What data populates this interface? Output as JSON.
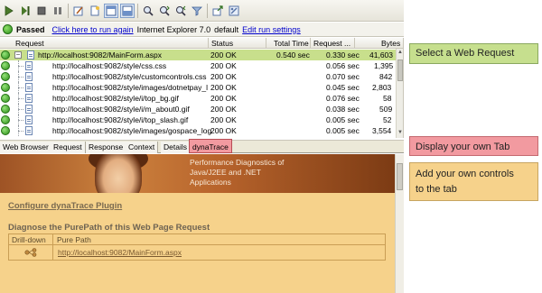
{
  "toolbar": {
    "buttons": [
      "play-icon",
      "step-icon",
      "stop-icon",
      "pause-icon",
      "edit-icon",
      "new-document-icon",
      "view-list-icon",
      "view-split-icon",
      "search-icon",
      "search-next-icon",
      "search-prev-icon",
      "filter-icon",
      "export-icon",
      "settings-icon"
    ],
    "active_button": "view-list-icon"
  },
  "run": {
    "status": "Passed",
    "run_again_link": "Click here to run again",
    "browser": "Internet Explorer 7.0",
    "profile": "default",
    "edit_settings_link": "Edit run settings"
  },
  "grid": {
    "headers": {
      "request": "Request",
      "status": "Status",
      "total_time": "Total Time",
      "request_time": "Request ...",
      "bytes": "Bytes"
    },
    "rows": [
      {
        "url": "http://localhost:9082/MainForm.aspx",
        "status": "200 OK",
        "total": "0.540 sec",
        "request": "0.330 sec",
        "bytes": "41,603"
      },
      {
        "url": "http://localhost:9082/style/css.css",
        "status": "200 OK",
        "total": "",
        "request": "0.056 sec",
        "bytes": "1,395"
      },
      {
        "url": "http://localhost:9082/style/customcontrols.css",
        "status": "200 OK",
        "total": "",
        "request": "0.070 sec",
        "bytes": "842"
      },
      {
        "url": "http://localhost:9082/style/images/dotnetpay_l",
        "status": "200 OK",
        "total": "",
        "request": "0.045 sec",
        "bytes": "2,803"
      },
      {
        "url": "http://localhost:9082/style/i/top_bg.gif",
        "status": "200 OK",
        "total": "",
        "request": "0.076 sec",
        "bytes": "58"
      },
      {
        "url": "http://localhost:9082/style/i/m_about0.gif",
        "status": "200 OK",
        "total": "",
        "request": "0.038 sec",
        "bytes": "509"
      },
      {
        "url": "http://localhost:9082/style/i/top_slash.gif",
        "status": "200 OK",
        "total": "",
        "request": "0.005 sec",
        "bytes": "52"
      },
      {
        "url": "http://localhost:9082/style/images/gospace_log",
        "status": "200 OK",
        "total": "",
        "request": "0.005 sec",
        "bytes": "3,554"
      }
    ]
  },
  "tabs": [
    "Web Browser",
    "Request",
    "Response",
    "Context",
    "Details",
    "dynaTrace"
  ],
  "active_tab": "dynaTrace",
  "panel": {
    "tagline_lines": [
      "Performance Diagnostics of",
      "Java/J2EE and .NET",
      "Applications"
    ],
    "configure_link": "Configure dynaTrace Plugin",
    "diagnose_title": "Diagnose the PurePath of this Web Page Request",
    "table_headers": {
      "drill": "Drill-down",
      "purepath": "Pure Path"
    },
    "purepath_link": "http://localhost:9082/MainForm.aspx"
  },
  "callouts": {
    "select": "Select a Web Request",
    "display": "Display your own Tab",
    "add_line1": "Add your own controls",
    "add_line2": "to the tab"
  },
  "colors": {
    "selection": "#c8df8c",
    "tab_highlight": "#f29aa0",
    "panel_bg": "#f6d28b"
  }
}
